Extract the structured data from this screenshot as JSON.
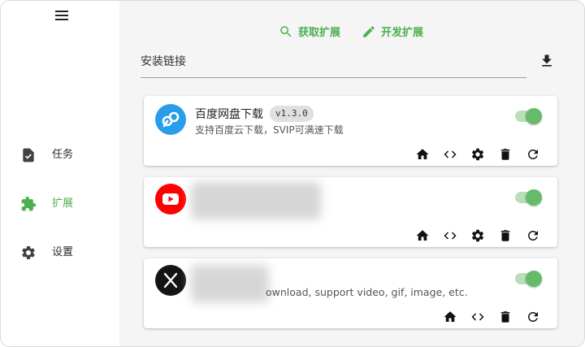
{
  "sidebar": {
    "items": [
      {
        "label": "任务",
        "icon": "task-icon",
        "active": false
      },
      {
        "label": "扩展",
        "icon": "puzzle-icon",
        "active": true
      },
      {
        "label": "设置",
        "icon": "gear-icon",
        "active": false
      }
    ]
  },
  "header": {
    "get_extension": "获取扩展",
    "dev_extension": "开发扩展"
  },
  "install": {
    "label": "安装链接"
  },
  "extensions": [
    {
      "name": "百度网盘下载",
      "version": "v1.3.0",
      "description": "支持百度云下载，SVIP可满速下载",
      "enabled": true,
      "logo": "baidu-netdisk-icon"
    },
    {
      "name": "",
      "version": "",
      "description": "",
      "enabled": true,
      "logo": "youtube-icon"
    },
    {
      "name": "",
      "version": "",
      "description": "ownload, support video, gif, image, etc.",
      "enabled": true,
      "logo": "x-twitter-icon"
    }
  ],
  "colors": {
    "accent": "#4caf50",
    "sidebar_bg": "#ffffff",
    "main_bg": "#f5f5f5"
  }
}
